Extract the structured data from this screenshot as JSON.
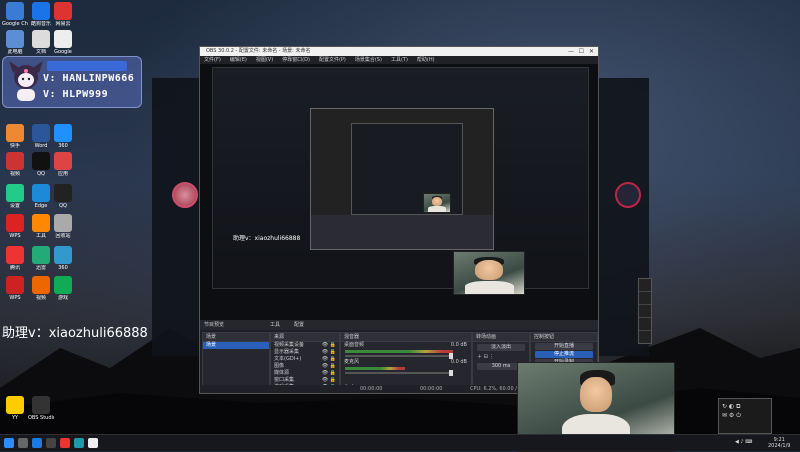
{
  "desktop": {
    "icons": [
      {
        "label": "Google Chrome",
        "color": "#3a7bd5"
      },
      {
        "label": "酷狗音乐",
        "color": "#1a73e8"
      },
      {
        "label": "网易云",
        "color": "#d33"
      },
      {
        "label": "此电脑",
        "color": "#5c8ed6"
      },
      {
        "label": "文档",
        "color": "#dcdcdc"
      },
      {
        "label": "Google",
        "color": "#eee"
      },
      {
        "label": "快手",
        "color": "#e83"
      },
      {
        "label": "Word",
        "color": "#2b579a"
      },
      {
        "label": "360",
        "color": "#1e90ff"
      },
      {
        "label": "视频",
        "color": "#c33"
      },
      {
        "label": "QQ",
        "color": "#111"
      },
      {
        "label": "应用",
        "color": "#d44"
      },
      {
        "label": "设置",
        "color": "#2c8"
      },
      {
        "label": "Edge",
        "color": "#1c8ad8"
      },
      {
        "label": "QQ",
        "color": "#222"
      },
      {
        "label": "WPS",
        "color": "#d22"
      },
      {
        "label": "工具",
        "color": "#f80"
      },
      {
        "label": "回收站",
        "color": "#aaa"
      },
      {
        "label": "腾讯",
        "color": "#e33"
      },
      {
        "label": "迅雷",
        "color": "#2a7"
      },
      {
        "label": "360",
        "color": "#39c"
      },
      {
        "label": "WPS",
        "color": "#c22"
      },
      {
        "label": "视频",
        "color": "#e60"
      },
      {
        "label": "游戏",
        "color": "#1a5"
      },
      {
        "label": "YY",
        "color": "#fc0"
      },
      {
        "label": "OBS Studio",
        "color": "#333"
      }
    ],
    "card": {
      "line1": "V:  HANLINPW666",
      "line2": "V:  HLPW999"
    },
    "assistant_text": "助理v：xiaozhuli66888"
  },
  "obs": {
    "title": "OBS 30.0.2 - 配置文件: 未命名 - 场景: 未命名",
    "menu": [
      "文件(F)",
      "编辑(E)",
      "视图(V)",
      "停靠窗口(D)",
      "配置文件(P)",
      "场景集合(S)",
      "工具(T)",
      "帮助(H)"
    ],
    "nested_nick": "助理v：xiaozhuli66888",
    "dock_tabs": [
      "节目预览",
      "工具",
      "配置"
    ],
    "scenes": {
      "header": "场景",
      "items": [
        "场景"
      ]
    },
    "sources": {
      "header": "来源",
      "items": [
        "视频采集设备",
        "显示器采集",
        "文本(GDI+)",
        "图像",
        "媒体源",
        "窗口采集",
        "游戏采集"
      ]
    },
    "mixer": {
      "header": "混音器",
      "tracks": [
        {
          "name": "桌面音频",
          "db": "0.0 dB"
        },
        {
          "name": "麦克风",
          "db": "0.0 dB"
        }
      ]
    },
    "transitions": {
      "header": "转场动画",
      "type": "淡入淡出",
      "duration": "300 ms"
    },
    "controls": {
      "header": "控制按钮",
      "buttons": [
        "开始直播",
        "停止推流",
        "开始录制",
        "虚拟摄像机",
        "工作室模式",
        "设置",
        "退出"
      ]
    },
    "status": {
      "fps": "CPU: 6.2%, 60.00 / 60.00 FPS",
      "time1": "00:00:00",
      "time2": "00:00:00"
    }
  },
  "taskbar": {
    "time": "9:21",
    "date": "2024/1/9"
  }
}
